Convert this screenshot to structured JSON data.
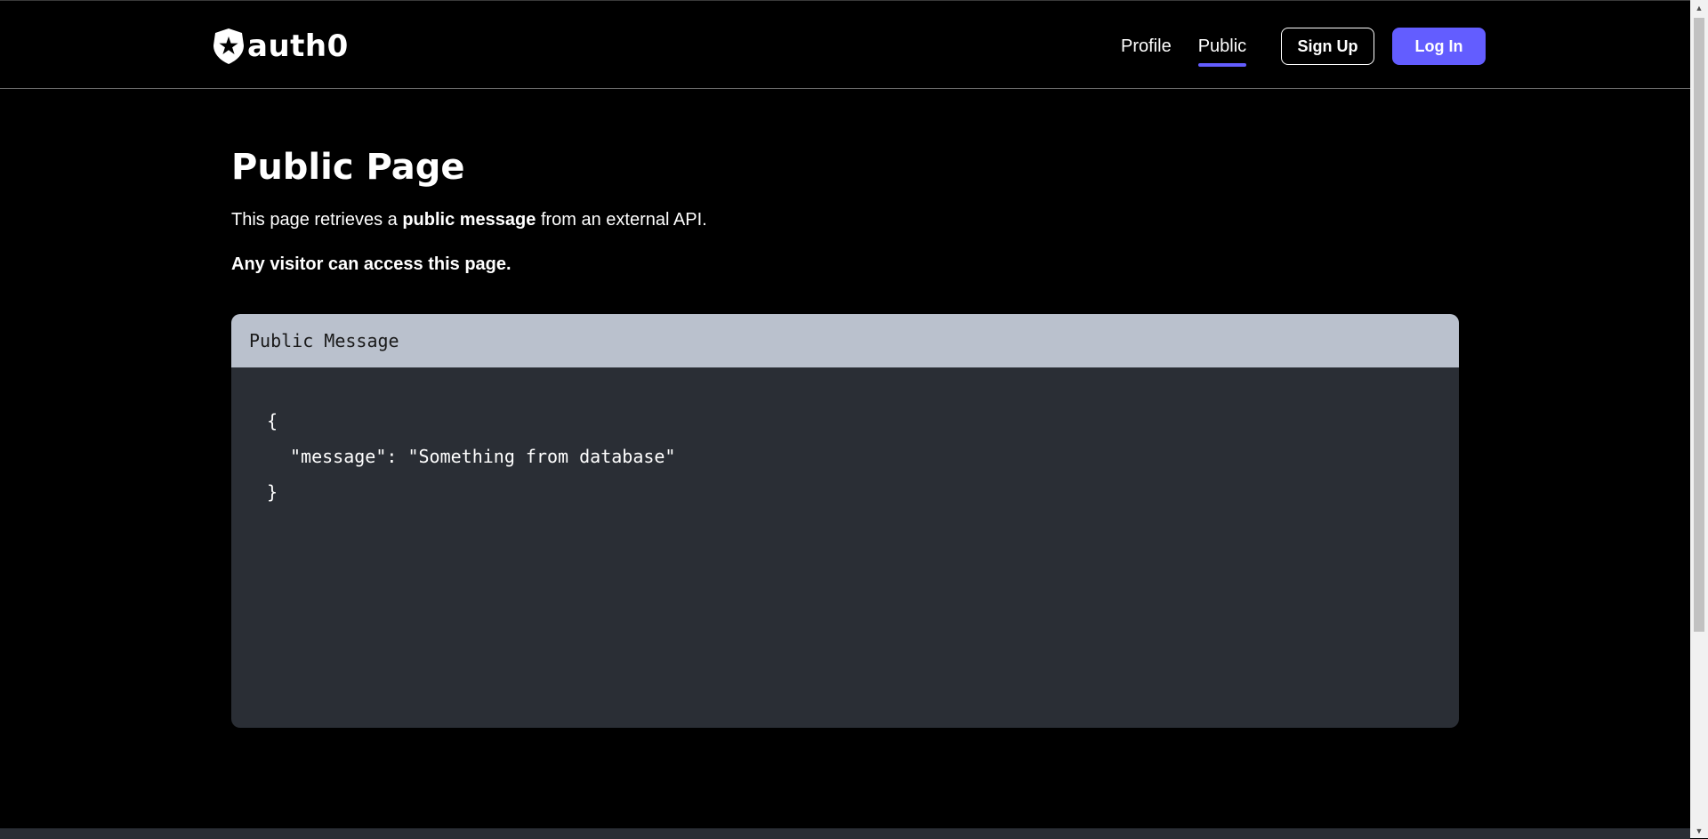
{
  "brand": {
    "name": "auth0"
  },
  "nav": {
    "links": [
      {
        "label": "Profile",
        "active": false
      },
      {
        "label": "Public",
        "active": true
      }
    ],
    "signup_label": "Sign Up",
    "login_label": "Log In"
  },
  "page": {
    "title": "Public Page",
    "desc_prefix": "This page retrieves a ",
    "desc_bold": "public message",
    "desc_suffix": " from an external API.",
    "note": "Any visitor can access this page."
  },
  "code_card": {
    "header": "Public Message",
    "line_open": "{",
    "line_message": "\"message\": \"Something from database\"",
    "line_close": "}"
  },
  "colors": {
    "accent": "#635dff",
    "background": "#000000",
    "card_header": "#bac1cd",
    "card_body": "#2a2e35"
  },
  "icons": {
    "logo": "auth0-shield-star-icon",
    "scroll_up": "scroll-up-arrow-icon",
    "scroll_down": "scroll-down-arrow-icon"
  }
}
